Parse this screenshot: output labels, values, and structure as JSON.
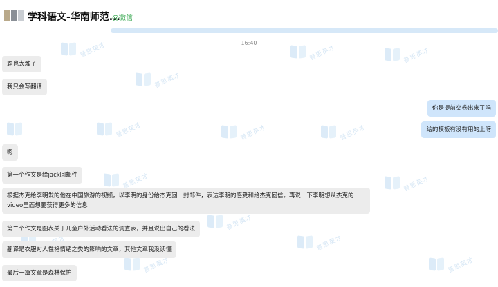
{
  "header": {
    "title": "学科语文-华南师范...",
    "wechat_tag": "@微信"
  },
  "time": "16:40",
  "watermark_text": "普思英才",
  "messages": [
    {
      "side": "left",
      "text": "题也太难了"
    },
    {
      "side": "left",
      "text": "我只会写翻译"
    },
    {
      "side": "right",
      "text": "你是提前交卷出来了吗"
    },
    {
      "side": "right",
      "text": "给的模板有没有用的上呀"
    },
    {
      "side": "left",
      "text": "嗯"
    },
    {
      "side": "left",
      "text": "第一个作文是给jack回邮件"
    },
    {
      "side": "left",
      "text": "根据杰克给李明发的他在中国旅游的视频，以李明的身份给杰克回一封邮件，表达李明的感受和给杰克回信。再说一下李明想从杰克的video里面想要获得更多的信息"
    },
    {
      "side": "left",
      "text": "第二个作文是图表关于儿童户外活动看法的调查表，并且说出自己的看法"
    },
    {
      "side": "left",
      "text": "翻译是衣服对人性格情绪之类的影响的文章，其他文章我没读懂"
    },
    {
      "side": "left",
      "text": "最后一篇文章是森林保护"
    }
  ]
}
